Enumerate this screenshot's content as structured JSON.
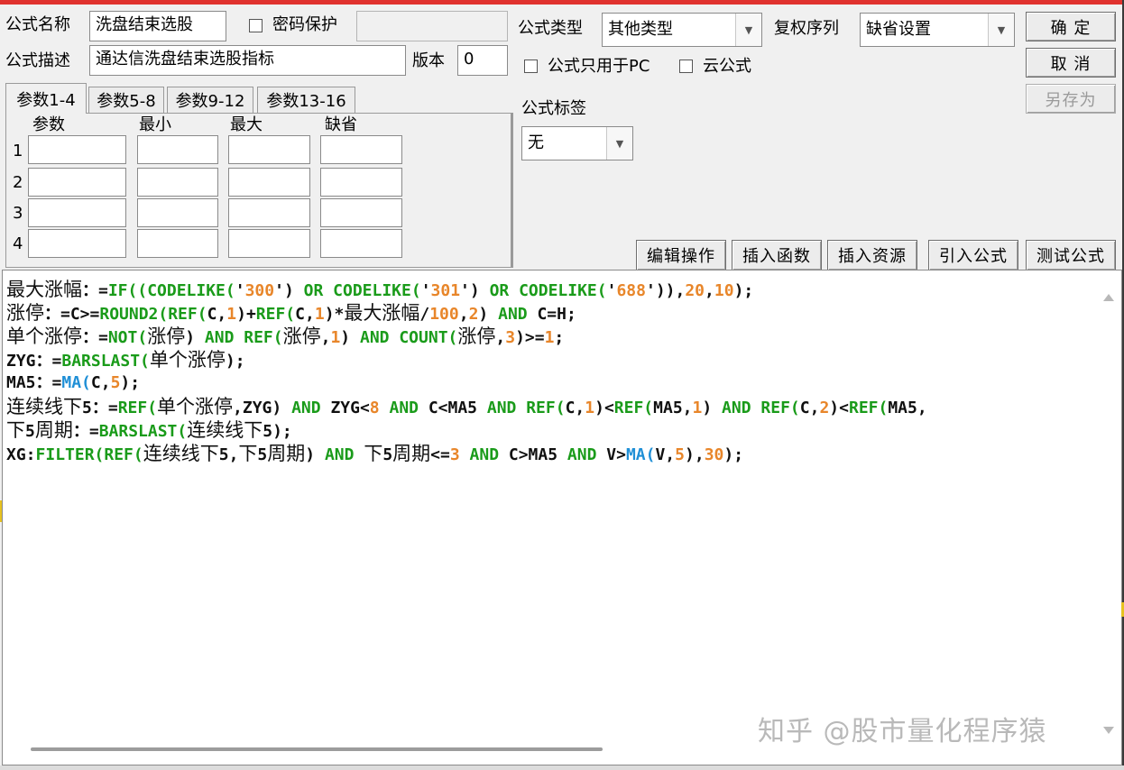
{
  "form": {
    "name_label": "公式名称",
    "name_value": "洗盘结束选股",
    "password_label": "密码保护",
    "desc_label": "公式描述",
    "desc_value": "通达信洗盘结束选股指标",
    "version_label": "版本",
    "version_value": "0",
    "type_label": "公式类型",
    "type_value": "其他类型",
    "rights_label": "复权序列",
    "rights_value": "缺省设置",
    "pc_only_label": "公式只用于PC",
    "cloud_label": "云公式",
    "tag_label": "公式标签",
    "tag_value": "无"
  },
  "buttons": {
    "confirm": "确 定",
    "cancel": "取 消",
    "save_as": "另存为",
    "edit_ops": "编辑操作",
    "insert_func": "插入函数",
    "insert_res": "插入资源",
    "import_formula": "引入公式",
    "test_formula": "测试公式"
  },
  "tabs": [
    "参数1-4",
    "参数5-8",
    "参数9-12",
    "参数13-16"
  ],
  "params": {
    "headers": [
      "参数",
      "最小",
      "最大",
      "缺省"
    ],
    "rows": [
      "1",
      "2",
      "3",
      "4"
    ]
  },
  "code_lines": [
    [
      [
        "cn",
        "最大涨幅"
      ],
      [
        "",
        "：="
      ],
      [
        "k",
        "IF(("
      ],
      [
        "k",
        "CODELIKE("
      ],
      [
        "",
        "'"
      ],
      [
        "n",
        "300"
      ],
      [
        "",
        "') "
      ],
      [
        "k",
        "OR "
      ],
      [
        "k",
        "CODELIKE("
      ],
      [
        "",
        "'"
      ],
      [
        "n",
        "301"
      ],
      [
        "",
        "') "
      ],
      [
        "k",
        "OR "
      ],
      [
        "k",
        "CODELIKE("
      ],
      [
        "",
        "'"
      ],
      [
        "n",
        "688"
      ],
      [
        "",
        "'))"
      ],
      [
        "",
        ","
      ],
      [
        "n",
        "20"
      ],
      [
        "",
        ","
      ],
      [
        "n",
        "10"
      ],
      [
        "",
        ");"
      ]
    ],
    [
      [
        "cn",
        "涨停"
      ],
      [
        "",
        "：=C>="
      ],
      [
        "k",
        "ROUND2("
      ],
      [
        "k",
        "REF("
      ],
      [
        "",
        "C,"
      ],
      [
        "n",
        "1"
      ],
      [
        "",
        ")+"
      ],
      [
        "k",
        "REF("
      ],
      [
        "",
        "C,"
      ],
      [
        "n",
        "1"
      ],
      [
        "",
        ")*"
      ],
      [
        "cn",
        "最大涨幅"
      ],
      [
        "",
        "/"
      ],
      [
        "n",
        "100"
      ],
      [
        "",
        ","
      ],
      [
        "n",
        "2"
      ],
      [
        "",
        ") "
      ],
      [
        "k",
        "AND "
      ],
      [
        "",
        "C=H;"
      ]
    ],
    [
      [
        "cn",
        "单个涨停"
      ],
      [
        "",
        "：="
      ],
      [
        "k",
        "NOT("
      ],
      [
        "cn",
        "涨停"
      ],
      [
        "",
        ") "
      ],
      [
        "k",
        "AND "
      ],
      [
        "k",
        "REF("
      ],
      [
        "cn",
        "涨停"
      ],
      [
        "",
        ","
      ],
      [
        "n",
        "1"
      ],
      [
        "",
        ") "
      ],
      [
        "k",
        "AND "
      ],
      [
        "k",
        "COUNT("
      ],
      [
        "cn",
        "涨停"
      ],
      [
        "",
        ","
      ],
      [
        "n",
        "3"
      ],
      [
        "",
        ")>="
      ],
      [
        "n",
        "1"
      ],
      [
        "",
        ";"
      ]
    ],
    [
      [
        "",
        "ZYG：="
      ],
      [
        "k",
        "BARSLAST("
      ],
      [
        "cn",
        "单个涨停"
      ],
      [
        "",
        ");"
      ]
    ],
    [
      [
        "",
        "MA5：="
      ],
      [
        "f",
        "MA("
      ],
      [
        "",
        "C,"
      ],
      [
        "n",
        "5"
      ],
      [
        "",
        ");"
      ]
    ],
    [
      [
        "cn",
        "连续线下"
      ],
      [
        "",
        "5：="
      ],
      [
        "k",
        "REF("
      ],
      [
        "cn",
        "单个涨停"
      ],
      [
        "",
        ",ZYG) "
      ],
      [
        "k",
        "AND "
      ],
      [
        "",
        "ZYG<"
      ],
      [
        "n",
        "8"
      ],
      [
        "",
        ""
      ],
      [
        "k",
        " AND "
      ],
      [
        "",
        "C<MA5 "
      ],
      [
        "k",
        "AND "
      ],
      [
        "k",
        "REF("
      ],
      [
        "",
        "C,"
      ],
      [
        "n",
        "1"
      ],
      [
        "",
        ")<"
      ],
      [
        "k",
        "REF("
      ],
      [
        "",
        "MA5,"
      ],
      [
        "n",
        "1"
      ],
      [
        "",
        ") "
      ],
      [
        "k",
        "AND "
      ],
      [
        "k",
        "REF("
      ],
      [
        "",
        "C,"
      ],
      [
        "n",
        "2"
      ],
      [
        "",
        ")<"
      ],
      [
        "k",
        "REF("
      ],
      [
        "",
        "MA5,"
      ]
    ],
    [
      [
        "cn",
        "下"
      ],
      [
        "",
        "5"
      ],
      [
        "cn",
        "周期"
      ],
      [
        "",
        "：="
      ],
      [
        "k",
        "BARSLAST("
      ],
      [
        "cn",
        "连续线下"
      ],
      [
        "",
        "5);"
      ]
    ],
    [
      [
        "",
        "XG:"
      ],
      [
        "k",
        "FILTER("
      ],
      [
        "k",
        "REF("
      ],
      [
        "cn",
        "连续线下"
      ],
      [
        "",
        "5,"
      ],
      [
        "cn",
        "下"
      ],
      [
        "",
        "5"
      ],
      [
        "cn",
        "周期"
      ],
      [
        "",
        ") "
      ],
      [
        "k",
        "AND "
      ],
      [
        "cn",
        "下"
      ],
      [
        "",
        "5"
      ],
      [
        "cn",
        "周期"
      ],
      [
        "",
        "<="
      ],
      [
        "n",
        "3"
      ],
      [
        "k",
        " AND "
      ],
      [
        "",
        "C>MA5 "
      ],
      [
        "k",
        "AND "
      ],
      [
        "",
        "V>"
      ],
      [
        "f",
        "MA("
      ],
      [
        "",
        "V,"
      ],
      [
        "n",
        "5"
      ],
      [
        "",
        "),"
      ],
      [
        "n",
        "30"
      ],
      [
        "",
        ");"
      ]
    ]
  ],
  "watermark": "知乎 @股市量化程序猿"
}
